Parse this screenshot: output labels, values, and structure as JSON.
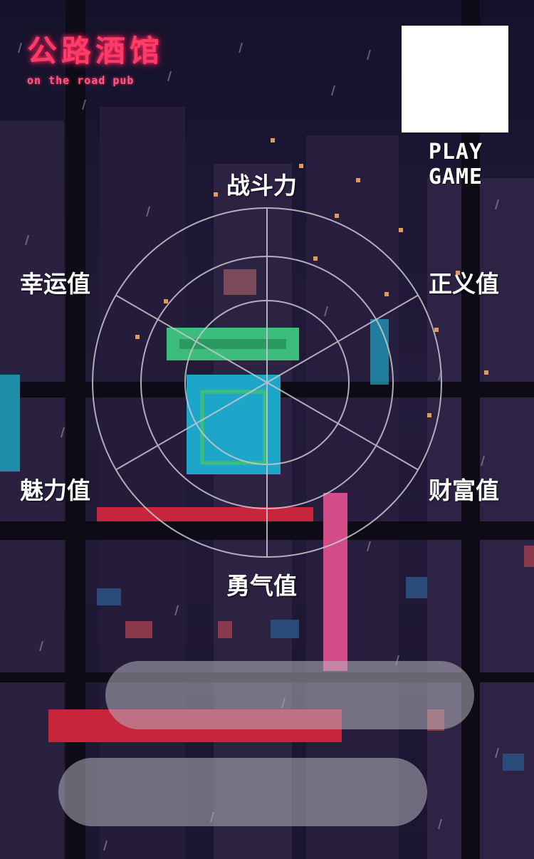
{
  "logo": {
    "title": "公路酒馆",
    "subtitle": "on the road pub"
  },
  "play_game": "PLAY GAME",
  "radar": {
    "attributes": [
      "战斗力",
      "正义值",
      "财富值",
      "勇气值",
      "魅力值",
      "幸运值"
    ]
  },
  "colors": {
    "sky": "#1a1530",
    "neon_pink": "#ff3b67",
    "neon_green": "#3dbd7d",
    "neon_cyan": "#1ea6c8",
    "neon_red": "#c8243c"
  }
}
